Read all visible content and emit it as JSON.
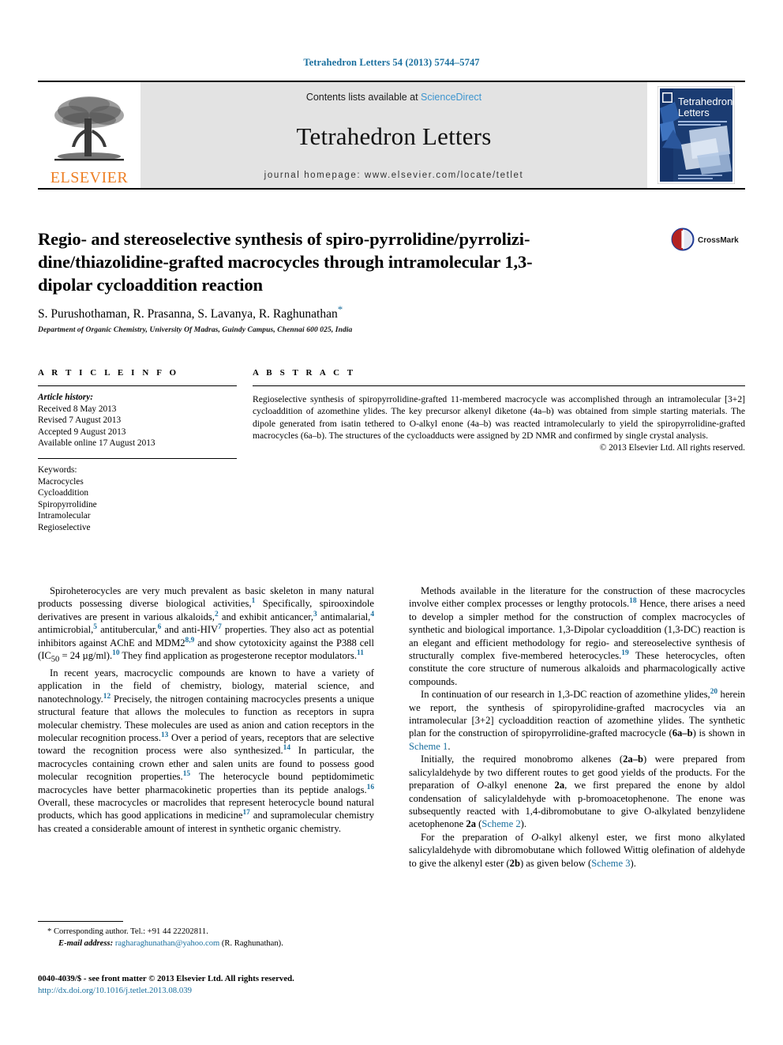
{
  "running_head": "Tetrahedron Letters 54 (2013) 5744–5747",
  "masthead": {
    "publisher_word": "ELSEVIER",
    "contents_prefix": "Contents lists available at ",
    "contents_link": "ScienceDirect",
    "journal_name": "Tetrahedron Letters",
    "homepage": "journal homepage: www.elsevier.com/locate/tetlet",
    "cover_title_line1": "Tetrahedron",
    "cover_title_line2": "Letters"
  },
  "article": {
    "title": "Regio- and stereoselective synthesis of spiro-pyrrolidine/pyrrolizi-dine/thiazolidine-grafted macrocycles through intramolecular 1,3-dipolar cycloaddition reaction",
    "title_line1": "Regio- and stereoselective synthesis of spiro-pyrrolidine/pyrrolizi-",
    "title_line2": "dine/thiazolidine-grafted macrocycles through intramolecular 1,3-",
    "title_line3": "dipolar cycloaddition reaction",
    "authors": "S. Purushothaman, R. Prasanna, S. Lavanya, R. Raghunathan",
    "author_marker": "*",
    "affiliation": "Department of Organic Chemistry, University Of Madras, Guindy Campus, Chennai 600 025, India",
    "crossmark_label": "CrossMark"
  },
  "info": {
    "heading": "A R T I C L E   I N F O",
    "history_label": "Article history:",
    "history": [
      "Received 8 May 2013",
      "Revised 7 August 2013",
      "Accepted 9 August 2013",
      "Available online 17 August 2013"
    ],
    "keywords_label": "Keywords:",
    "keywords": [
      "Macrocycles",
      "Cycloaddition",
      "Spiropyrrolidine",
      "Intramolecular",
      "Regioselective"
    ]
  },
  "abstract": {
    "heading": "A B S T R A C T",
    "text": "Regioselective synthesis of spiropyrrolidine-grafted 11-membered macrocycle was accomplished through an intramolecular [3+2] cycloaddition of azomethine ylides. The key precursor alkenyl diketone (4a–b) was obtained from simple starting materials. The dipole generated from isatin tethered to O-alkyl enone (4a–b) was reacted intramolecularly to yield the spiropyrrolidine-grafted macrocycles (6a–b). The structures of the cycloadducts were assigned by 2D NMR and confirmed by single crystal analysis.",
    "copyright": "© 2013 Elsevier Ltd. All rights reserved."
  },
  "footnote": {
    "corresponding": "* Corresponding author. Tel.: +91 44 22202811.",
    "email_label": "E-mail address:",
    "email": "ragharaghunathan@yahoo.com",
    "email_owner": "(R. Raghunathan)."
  },
  "imprint": {
    "issn_line": "0040-4039/$ - see front matter © 2013 Elsevier Ltd. All rights reserved.",
    "doi": "http://dx.doi.org/10.1016/j.tetlet.2013.08.039"
  },
  "colors": {
    "link": "#1a6f9e",
    "sciencedirect": "#3d95cf",
    "elsevier_orange": "#ee7f24",
    "band_gray": "#e3e3e3"
  }
}
